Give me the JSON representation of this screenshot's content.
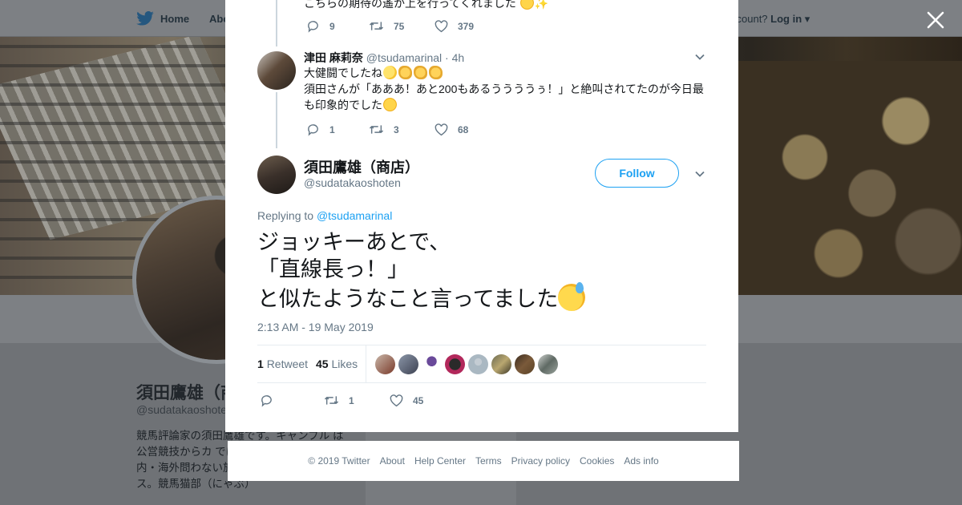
{
  "background": {
    "nav": {
      "home": "Home",
      "about": "Abo",
      "account_prompt": "ccount?",
      "login": "Log in"
    },
    "profile_name": "須田鷹雄（商",
    "profile_handle": "@sudatakaoshote",
    "bio": "競馬評論家の須田鷹雄です。キャンブル は公営競技からカ では闘鶏までやっ は国内・海外問わない旅打ち。野球はオ リックス。競馬猫部（にゃぶ）"
  },
  "modal": {
    "prev_tweet": {
      "text_fragment": "こちらの期待の遙か上を行ってくれました",
      "replies": "9",
      "retweets": "75",
      "likes": "379"
    },
    "reply": {
      "name": "津田 麻莉奈",
      "handle": "@tsudamarinal",
      "time": "· 4h",
      "line1": "大健闘でしたね",
      "line2": "須田さんが「あああ！あと200もあるううううぅ！」と絶叫されてたのが今日最も印象的でした",
      "replies": "1",
      "retweets": "3",
      "likes": "68"
    },
    "main_tweet": {
      "name": "須田鷹雄（商店）",
      "handle": "@sudatakaoshoten",
      "follow_label": "Follow",
      "replying_prefix": "Replying to",
      "replying_to": "@tsudamarinal",
      "line1": "ジョッキーあとで、",
      "line2": "「直線長っ！」",
      "line3": "と似たようなこと言ってました",
      "timestamp": "2:13 AM - 19 May 2019",
      "retweet_count": "1",
      "retweet_label": "Retweet",
      "like_count": "45",
      "like_label": "Likes",
      "action_retweets": "1",
      "action_likes": "45"
    }
  },
  "footer": {
    "copyright": "© 2019 Twitter",
    "links": [
      "About",
      "Help Center",
      "Terms",
      "Privacy policy",
      "Cookies",
      "Ads info"
    ]
  },
  "colors": {
    "accent": "#1da1f2",
    "text": "#14171a",
    "muted": "#657786",
    "border": "#e6ecf0"
  }
}
